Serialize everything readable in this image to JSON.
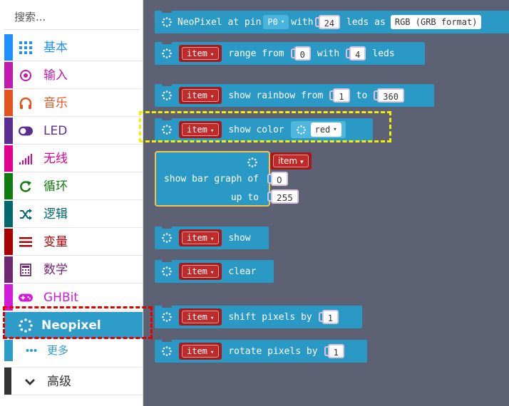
{
  "search": {
    "placeholder": "搜索..."
  },
  "categories": [
    {
      "key": "basic",
      "label": "基本",
      "color": "#1e90ff",
      "icon": "grid-icon"
    },
    {
      "key": "input",
      "label": "输入",
      "color": "#c01bac",
      "icon": "target-icon"
    },
    {
      "key": "music",
      "label": "音乐",
      "color": "#e4541e",
      "icon": "headphones-icon"
    },
    {
      "key": "led",
      "label": "LED",
      "color": "#5c2d91",
      "icon": "toggle-icon"
    },
    {
      "key": "radio",
      "label": "无线",
      "color": "#e3008c",
      "icon": "signal-icon"
    },
    {
      "key": "loops",
      "label": "循环",
      "color": "#107c10",
      "icon": "loop-icon"
    },
    {
      "key": "logic",
      "label": "逻辑",
      "color": "#006970",
      "icon": "shuffle-icon"
    },
    {
      "key": "variables",
      "label": "变量",
      "color": "#a80000",
      "icon": "list-icon"
    },
    {
      "key": "math",
      "label": "数学",
      "color": "#712672",
      "icon": "calculator-icon"
    },
    {
      "key": "ghbit",
      "label": "GHBit",
      "color": "#d01bd9",
      "icon": "gamepad-icon"
    },
    {
      "key": "neopixel",
      "label": "Neopixel",
      "color": "#2e9cc8",
      "icon": "neopixel-ring-icon"
    }
  ],
  "more": {
    "label": "更多",
    "color": "#2e9cc8",
    "icon": "dots-icon"
  },
  "advanced": {
    "label": "高级",
    "color": "#333333",
    "icon": "chevron-down-icon"
  },
  "blocks": {
    "init": {
      "text1": "NeoPixel at pin",
      "pin": "P0",
      "text2": "with",
      "leds": "24",
      "text3": "leds as",
      "mode": "RGB (GRB format)"
    },
    "range": {
      "var": "item",
      "text1": "range from",
      "from": "0",
      "text2": "with",
      "count": "4",
      "text3": "leds"
    },
    "rainbow": {
      "var": "item",
      "text1": "show rainbow from",
      "from": "1",
      "text2": "to",
      "to": "360"
    },
    "show_color": {
      "var": "item",
      "text1": "show color",
      "color": "red"
    },
    "bar_graph": {
      "var": "item",
      "text1": "show bar graph of",
      "value": "0",
      "text2": "up to",
      "max": "255"
    },
    "show": {
      "var": "item",
      "text1": "show"
    },
    "clear": {
      "var": "item",
      "text1": "clear"
    },
    "shift": {
      "var": "item",
      "text1": "shift pixels by",
      "offset": "1"
    },
    "rotate": {
      "var": "item",
      "text1": "rotate pixels by",
      "offset": "1"
    }
  },
  "colors": {
    "neopixel_block": "#2b99c6",
    "variable": "#a51a1a",
    "workspace": "#5c6173",
    "highlight_yellow": "#f6f000",
    "highlight_red": "#e20000"
  }
}
